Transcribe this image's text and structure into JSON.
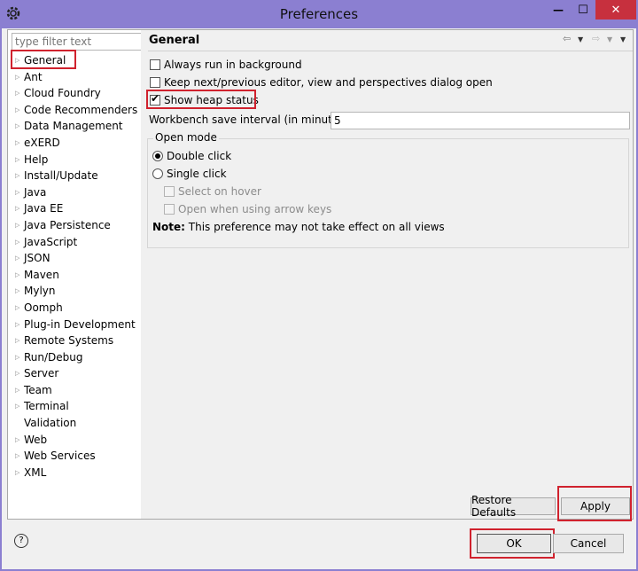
{
  "window": {
    "title": "Preferences",
    "minimize_glyph": "—",
    "maximize_glyph": "☐",
    "close_glyph": "✕"
  },
  "filter": {
    "placeholder": "type filter text"
  },
  "tree": {
    "items": [
      {
        "label": "General",
        "expandable": true
      },
      {
        "label": "Ant",
        "expandable": true
      },
      {
        "label": "Cloud Foundry",
        "expandable": true
      },
      {
        "label": "Code Recommenders",
        "expandable": true
      },
      {
        "label": "Data Management",
        "expandable": true
      },
      {
        "label": "eXERD",
        "expandable": true
      },
      {
        "label": "Help",
        "expandable": true
      },
      {
        "label": "Install/Update",
        "expandable": true
      },
      {
        "label": "Java",
        "expandable": true
      },
      {
        "label": "Java EE",
        "expandable": true
      },
      {
        "label": "Java Persistence",
        "expandable": true
      },
      {
        "label": "JavaScript",
        "expandable": true
      },
      {
        "label": "JSON",
        "expandable": true
      },
      {
        "label": "Maven",
        "expandable": true
      },
      {
        "label": "Mylyn",
        "expandable": true
      },
      {
        "label": "Oomph",
        "expandable": true
      },
      {
        "label": "Plug-in Development",
        "expandable": true
      },
      {
        "label": "Remote Systems",
        "expandable": true
      },
      {
        "label": "Run/Debug",
        "expandable": true
      },
      {
        "label": "Server",
        "expandable": true
      },
      {
        "label": "Team",
        "expandable": true
      },
      {
        "label": "Terminal",
        "expandable": true
      },
      {
        "label": "Validation",
        "expandable": false
      },
      {
        "label": "Web",
        "expandable": true
      },
      {
        "label": "Web Services",
        "expandable": true
      },
      {
        "label": "XML",
        "expandable": true
      }
    ]
  },
  "page": {
    "title": "General",
    "always_run_bg": "Always run in background",
    "keep_next_prev": "Keep next/previous editor, view and perspectives dialog open",
    "show_heap": "Show heap status",
    "interval_label": "Workbench save interval (in minutes):",
    "interval_value": "5",
    "open_mode_label": "Open mode",
    "double_click": "Double click",
    "single_click": "Single click",
    "select_on_hover": "Select on hover",
    "open_arrow_keys": "Open when using arrow keys",
    "note_bold": "Note:",
    "note_text": " This preference may not take effect on all views"
  },
  "buttons": {
    "restore_defaults": "Restore Defaults",
    "apply": "Apply",
    "ok": "OK",
    "cancel": "Cancel",
    "help": "?"
  },
  "colors": {
    "title_bar": "#8b7fd1",
    "close": "#c7303e",
    "highlight": "#d0222e"
  }
}
